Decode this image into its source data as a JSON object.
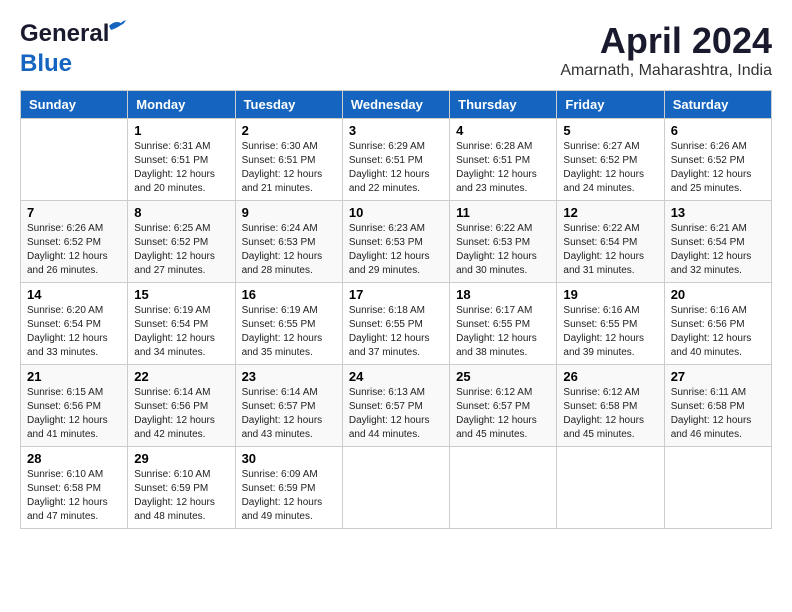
{
  "header": {
    "logo_line1": "General",
    "logo_line2": "Blue",
    "month": "April 2024",
    "location": "Amarnath, Maharashtra, India"
  },
  "weekdays": [
    "Sunday",
    "Monday",
    "Tuesday",
    "Wednesday",
    "Thursday",
    "Friday",
    "Saturday"
  ],
  "weeks": [
    [
      {
        "day": null,
        "info": null
      },
      {
        "day": "1",
        "info": "Sunrise: 6:31 AM\nSunset: 6:51 PM\nDaylight: 12 hours\nand 20 minutes."
      },
      {
        "day": "2",
        "info": "Sunrise: 6:30 AM\nSunset: 6:51 PM\nDaylight: 12 hours\nand 21 minutes."
      },
      {
        "day": "3",
        "info": "Sunrise: 6:29 AM\nSunset: 6:51 PM\nDaylight: 12 hours\nand 22 minutes."
      },
      {
        "day": "4",
        "info": "Sunrise: 6:28 AM\nSunset: 6:51 PM\nDaylight: 12 hours\nand 23 minutes."
      },
      {
        "day": "5",
        "info": "Sunrise: 6:27 AM\nSunset: 6:52 PM\nDaylight: 12 hours\nand 24 minutes."
      },
      {
        "day": "6",
        "info": "Sunrise: 6:26 AM\nSunset: 6:52 PM\nDaylight: 12 hours\nand 25 minutes."
      }
    ],
    [
      {
        "day": "7",
        "info": "Sunrise: 6:26 AM\nSunset: 6:52 PM\nDaylight: 12 hours\nand 26 minutes."
      },
      {
        "day": "8",
        "info": "Sunrise: 6:25 AM\nSunset: 6:52 PM\nDaylight: 12 hours\nand 27 minutes."
      },
      {
        "day": "9",
        "info": "Sunrise: 6:24 AM\nSunset: 6:53 PM\nDaylight: 12 hours\nand 28 minutes."
      },
      {
        "day": "10",
        "info": "Sunrise: 6:23 AM\nSunset: 6:53 PM\nDaylight: 12 hours\nand 29 minutes."
      },
      {
        "day": "11",
        "info": "Sunrise: 6:22 AM\nSunset: 6:53 PM\nDaylight: 12 hours\nand 30 minutes."
      },
      {
        "day": "12",
        "info": "Sunrise: 6:22 AM\nSunset: 6:54 PM\nDaylight: 12 hours\nand 31 minutes."
      },
      {
        "day": "13",
        "info": "Sunrise: 6:21 AM\nSunset: 6:54 PM\nDaylight: 12 hours\nand 32 minutes."
      }
    ],
    [
      {
        "day": "14",
        "info": "Sunrise: 6:20 AM\nSunset: 6:54 PM\nDaylight: 12 hours\nand 33 minutes."
      },
      {
        "day": "15",
        "info": "Sunrise: 6:19 AM\nSunset: 6:54 PM\nDaylight: 12 hours\nand 34 minutes."
      },
      {
        "day": "16",
        "info": "Sunrise: 6:19 AM\nSunset: 6:55 PM\nDaylight: 12 hours\nand 35 minutes."
      },
      {
        "day": "17",
        "info": "Sunrise: 6:18 AM\nSunset: 6:55 PM\nDaylight: 12 hours\nand 37 minutes."
      },
      {
        "day": "18",
        "info": "Sunrise: 6:17 AM\nSunset: 6:55 PM\nDaylight: 12 hours\nand 38 minutes."
      },
      {
        "day": "19",
        "info": "Sunrise: 6:16 AM\nSunset: 6:55 PM\nDaylight: 12 hours\nand 39 minutes."
      },
      {
        "day": "20",
        "info": "Sunrise: 6:16 AM\nSunset: 6:56 PM\nDaylight: 12 hours\nand 40 minutes."
      }
    ],
    [
      {
        "day": "21",
        "info": "Sunrise: 6:15 AM\nSunset: 6:56 PM\nDaylight: 12 hours\nand 41 minutes."
      },
      {
        "day": "22",
        "info": "Sunrise: 6:14 AM\nSunset: 6:56 PM\nDaylight: 12 hours\nand 42 minutes."
      },
      {
        "day": "23",
        "info": "Sunrise: 6:14 AM\nSunset: 6:57 PM\nDaylight: 12 hours\nand 43 minutes."
      },
      {
        "day": "24",
        "info": "Sunrise: 6:13 AM\nSunset: 6:57 PM\nDaylight: 12 hours\nand 44 minutes."
      },
      {
        "day": "25",
        "info": "Sunrise: 6:12 AM\nSunset: 6:57 PM\nDaylight: 12 hours\nand 45 minutes."
      },
      {
        "day": "26",
        "info": "Sunrise: 6:12 AM\nSunset: 6:58 PM\nDaylight: 12 hours\nand 45 minutes."
      },
      {
        "day": "27",
        "info": "Sunrise: 6:11 AM\nSunset: 6:58 PM\nDaylight: 12 hours\nand 46 minutes."
      }
    ],
    [
      {
        "day": "28",
        "info": "Sunrise: 6:10 AM\nSunset: 6:58 PM\nDaylight: 12 hours\nand 47 minutes."
      },
      {
        "day": "29",
        "info": "Sunrise: 6:10 AM\nSunset: 6:59 PM\nDaylight: 12 hours\nand 48 minutes."
      },
      {
        "day": "30",
        "info": "Sunrise: 6:09 AM\nSunset: 6:59 PM\nDaylight: 12 hours\nand 49 minutes."
      },
      {
        "day": null,
        "info": null
      },
      {
        "day": null,
        "info": null
      },
      {
        "day": null,
        "info": null
      },
      {
        "day": null,
        "info": null
      }
    ]
  ]
}
